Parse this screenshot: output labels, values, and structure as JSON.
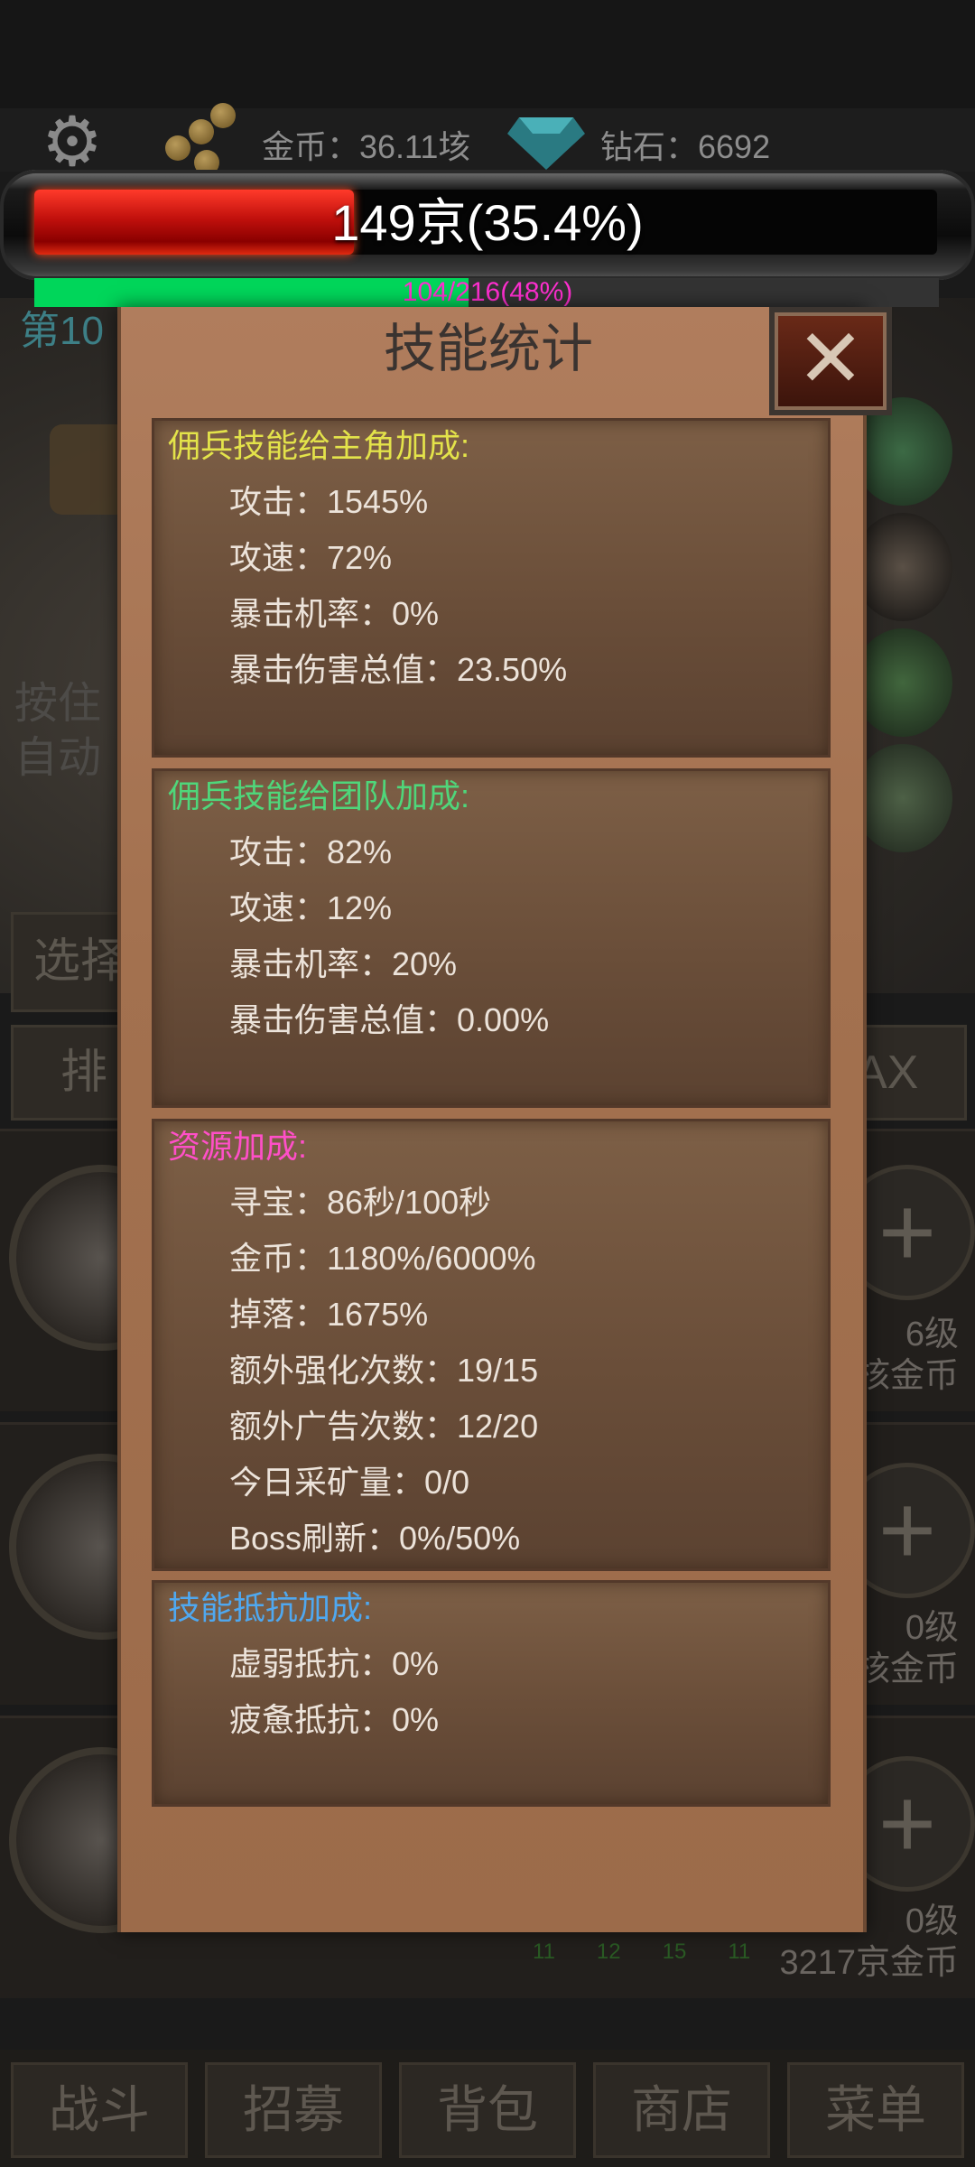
{
  "topbar": {
    "gold_label": "金币：36.11垓",
    "diamond_label": "钻石：6692"
  },
  "hp_bar": {
    "text": "149京(35.4%)",
    "fill_percent": 35.4,
    "fill_color": "#d01810"
  },
  "xp_bar": {
    "text": "104/216(48%)",
    "fill_percent": 48,
    "fill_color": "#00d65a",
    "text_color": "#ff2fd0"
  },
  "background": {
    "stage_partial": "第10",
    "hint_line1": "按住",
    "hint_line2": "自动",
    "select_button": "选择",
    "rank_button": "排",
    "max_button": "AX",
    "rows": [
      {
        "level": "6级",
        "cost": "核金币"
      },
      {
        "level": "0级",
        "cost": "核金币"
      },
      {
        "level": "0级",
        "cost": "3217京金币"
      }
    ],
    "small_numbers": [
      "11",
      "12",
      "15",
      "11"
    ]
  },
  "modal": {
    "title": "技能统计",
    "close_label": "✕",
    "sections": [
      {
        "title": "佣兵技能给主角加成:",
        "title_color": "#e3e34a",
        "stats": [
          "攻击：1545%",
          "攻速：72%",
          "暴击机率：0%",
          "暴击伤害总值：23.50%"
        ]
      },
      {
        "title": "佣兵技能给团队加成:",
        "title_color": "#4fd67a",
        "stats": [
          "攻击：82%",
          "攻速：12%",
          "暴击机率：20%",
          "暴击伤害总值：0.00%"
        ]
      },
      {
        "title": "资源加成:",
        "title_color": "#ff4fc8",
        "stats": [
          "寻宝：86秒/100秒",
          "金币：1180%/6000%",
          "掉落：1675%",
          "额外强化次数：19/15",
          "额外广告次数：12/20",
          "今日采矿量：0/0",
          "Boss刷新：0%/50%"
        ]
      },
      {
        "title": "技能抵抗加成:",
        "title_color": "#4fa8f0",
        "stats": [
          "虚弱抵抗：0%",
          "疲惫抵抗：0%"
        ]
      }
    ]
  },
  "bottom_nav": [
    "战斗",
    "招募",
    "背包",
    "商店",
    "菜单"
  ]
}
